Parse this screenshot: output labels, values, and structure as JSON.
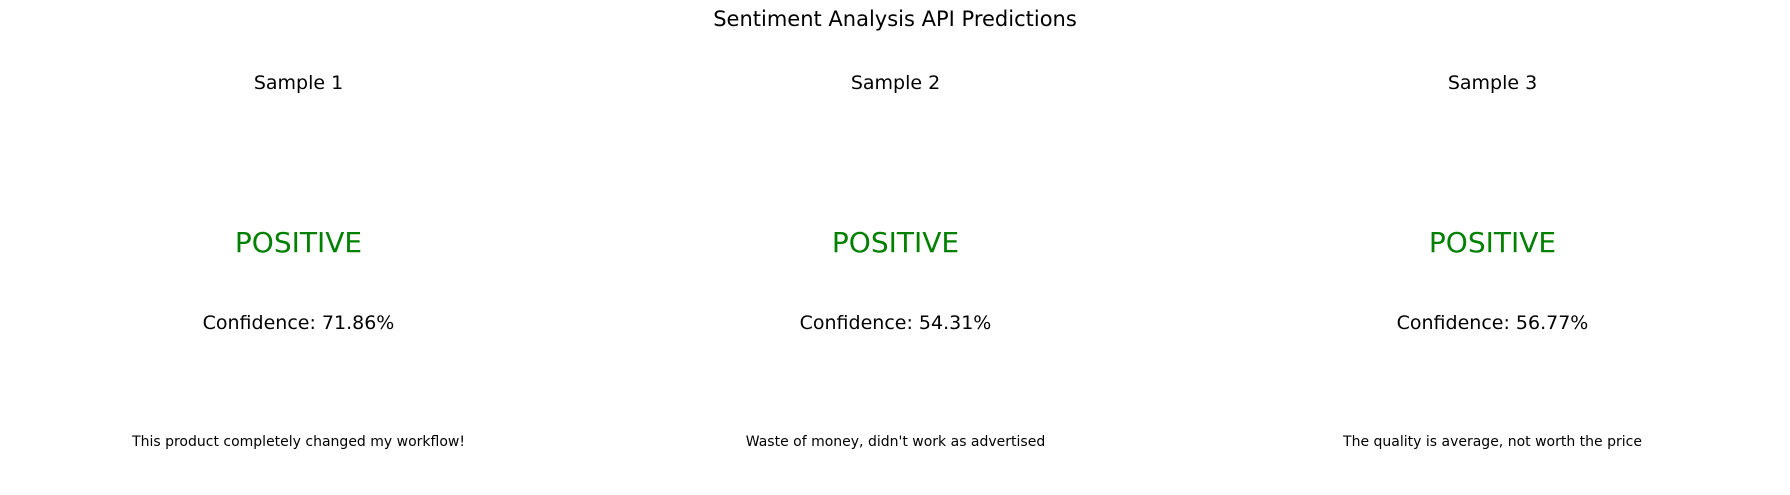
{
  "chart_data": {
    "type": "table",
    "title": "Sentiment Analysis API Predictions",
    "label_color": "#008000",
    "text_color": "#000000",
    "confidence_prefix": "Confidence: ",
    "samples": [
      {
        "title": "Sample 1",
        "label": "POSITIVE",
        "confidence": 71.86,
        "confidence_text": "71.86%",
        "text": "This product completely changed my workflow!"
      },
      {
        "title": "Sample 2",
        "label": "POSITIVE",
        "confidence": 54.31,
        "confidence_text": "54.31%",
        "text": "Waste of money, didn't work as advertised"
      },
      {
        "title": "Sample 3",
        "label": "POSITIVE",
        "confidence": 56.77,
        "confidence_text": "56.77%",
        "text": "The quality is average, not worth the price"
      }
    ]
  }
}
